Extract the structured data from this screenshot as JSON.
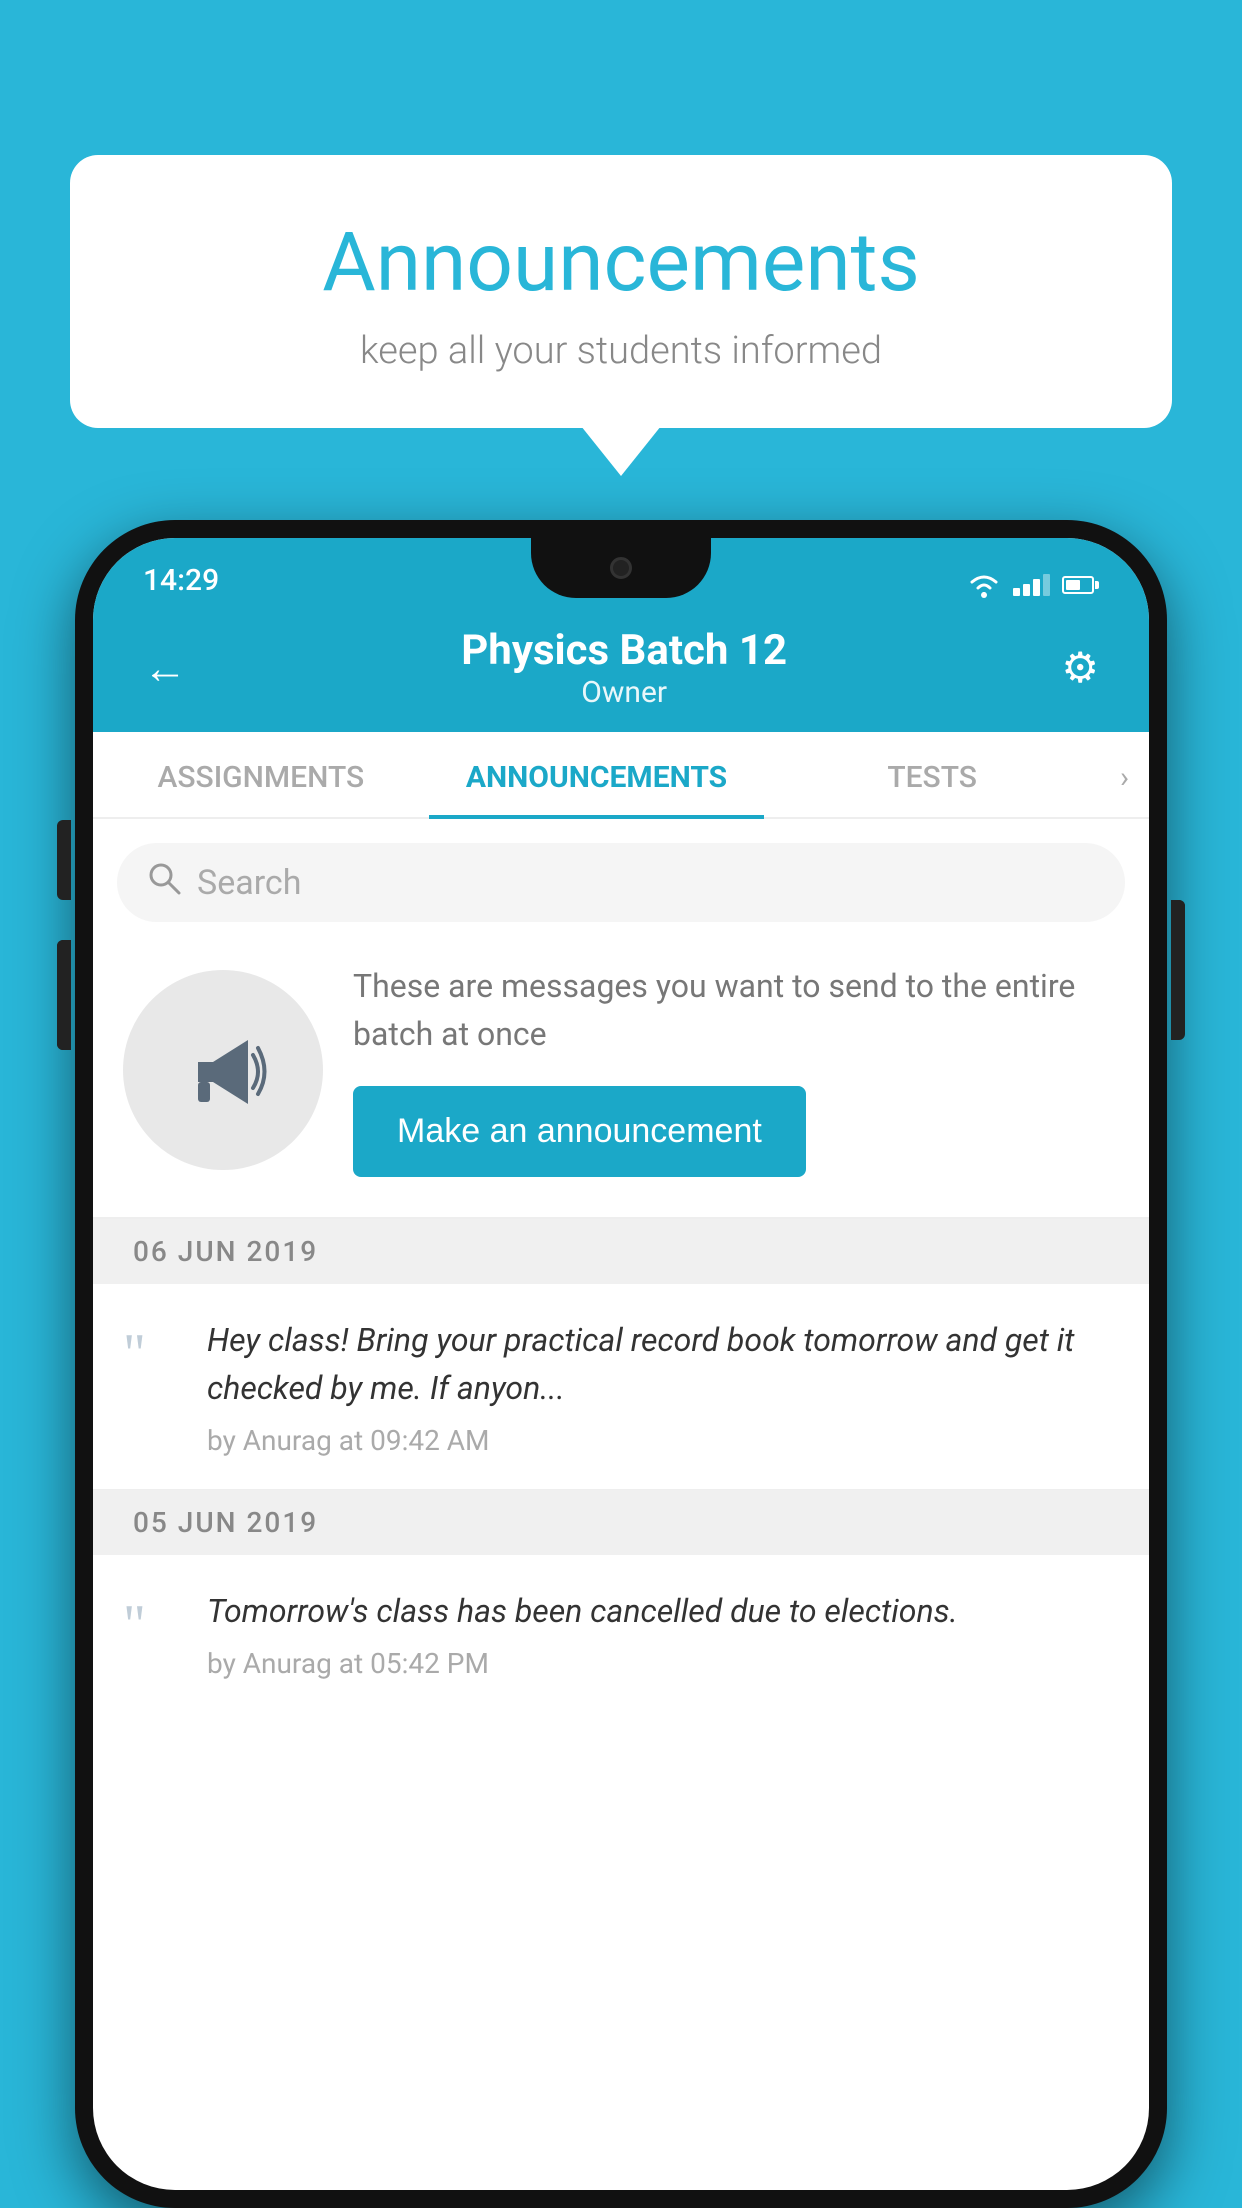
{
  "background_color": "#29B6D8",
  "speech_bubble": {
    "title": "Announcements",
    "subtitle": "keep all your students informed"
  },
  "phone": {
    "status_bar": {
      "time": "14:29"
    },
    "header": {
      "back_label": "←",
      "title": "Physics Batch 12",
      "subtitle": "Owner",
      "gear_icon": "⚙"
    },
    "tabs": [
      {
        "label": "ASSIGNMENTS",
        "active": false
      },
      {
        "label": "ANNOUNCEMENTS",
        "active": true
      },
      {
        "label": "TESTS",
        "active": false
      }
    ],
    "search": {
      "placeholder": "Search"
    },
    "announcement_cta": {
      "description": "These are messages you want to send to the entire batch at once",
      "button_label": "Make an announcement"
    },
    "announcements": [
      {
        "date": "06  JUN  2019",
        "text": "Hey class! Bring your practical record book tomorrow and get it checked by me. If anyon...",
        "meta": "by Anurag at 09:42 AM"
      },
      {
        "date": "05  JUN  2019",
        "text": "Tomorrow's class has been cancelled due to elections.",
        "meta": "by Anurag at 05:42 PM"
      }
    ]
  }
}
